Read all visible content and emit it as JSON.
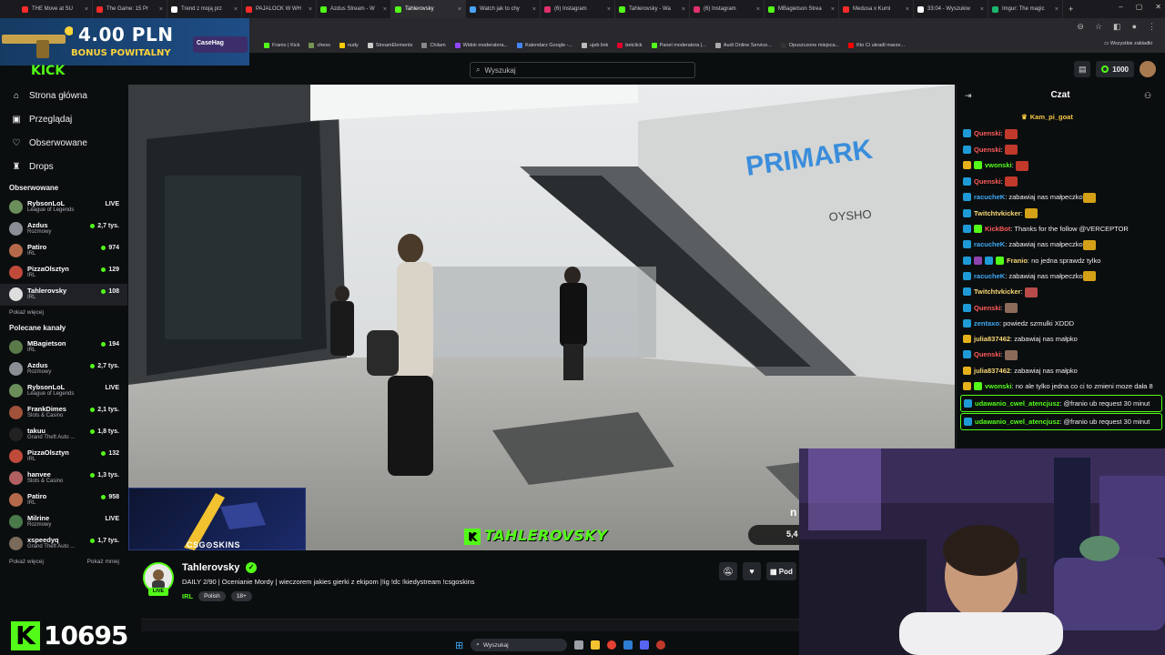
{
  "browser": {
    "tabs": [
      {
        "label": "THE Move at SU",
        "color": "#ff2b2b",
        "active": false
      },
      {
        "label": "The Game: 15 Pr",
        "color": "#ff2b2b",
        "active": false
      },
      {
        "label": "Trend z moją prz",
        "color": "#ffffff",
        "active": false
      },
      {
        "label": "PAJALOCK W WH",
        "color": "#ff2b2b",
        "active": false
      },
      {
        "label": "Azdus Stream - W",
        "color": "#53fc18",
        "active": false
      },
      {
        "label": "Tahlerovsky",
        "color": "#53fc18",
        "active": true
      },
      {
        "label": "Watch jak to chy",
        "color": "#4aa3ff",
        "active": false
      },
      {
        "label": "(6) Instagram",
        "color": "#e1306c",
        "active": false
      },
      {
        "label": "Tahlerovsky - Wa",
        "color": "#53fc18",
        "active": false
      },
      {
        "label": "(6) Instagram",
        "color": "#e1306c",
        "active": false
      },
      {
        "label": "MBagietson Strea",
        "color": "#53fc18",
        "active": false
      },
      {
        "label": "Medusa x Kumi",
        "color": "#ff2b2b",
        "active": false
      },
      {
        "label": "33:04 - Wyszukiw",
        "color": "#ffffff",
        "active": false
      },
      {
        "label": "Imgur: The magic",
        "color": "#1bb76e",
        "active": false
      }
    ],
    "bookmarks": [
      {
        "label": "Franio | Kick",
        "color": "#53fc18"
      },
      {
        "label": "chess",
        "color": "#769656"
      },
      {
        "label": "nudy",
        "color": "#ffcc00"
      },
      {
        "label": "StreamElements",
        "color": "#cccccc"
      },
      {
        "label": "Chilam",
        "color": "#888888"
      },
      {
        "label": "Widok moderatora...",
        "color": "#9147ff"
      },
      {
        "label": "Kalendarz Google -...",
        "color": "#4285f4"
      },
      {
        "label": "ujeb link",
        "color": "#bbbbbb"
      },
      {
        "label": "betclick",
        "color": "#e4002b"
      },
      {
        "label": "Panel moderatora |...",
        "color": "#53fc18"
      },
      {
        "label": "Audi Online Service...",
        "color": "#aaaaaa"
      },
      {
        "label": "Opuszczone miejsca...",
        "color": "#333333"
      },
      {
        "label": "Kto Ci ukradł marze...",
        "color": "#ff0000"
      }
    ],
    "bookmarks_all": "Wszystkie zakładki"
  },
  "promo": {
    "amount": "4.00 PLN",
    "subtitle": "BONUS POWITALNY",
    "brand": "CaseHag"
  },
  "header": {
    "search_placeholder": "Wyszukaj",
    "points": "1000"
  },
  "sidebar": {
    "nav": [
      {
        "label": "Strona główna",
        "icon": "home-icon",
        "glyph": "⌂"
      },
      {
        "label": "Przeglądaj",
        "icon": "browse-icon",
        "glyph": "▣"
      },
      {
        "label": "Obserwowane",
        "icon": "heart-icon",
        "glyph": "♡"
      },
      {
        "label": "Drops",
        "icon": "drops-icon",
        "glyph": "♜"
      }
    ],
    "followed_title": "Obserwowane",
    "followed": [
      {
        "name": "RybsonLoL",
        "category": "League of Legends",
        "viewers": "LIVE",
        "dot": false,
        "color": "#6b8e5a"
      },
      {
        "name": "Azdus",
        "category": "Rozmowy",
        "viewers": "2,7 tys.",
        "dot": true,
        "color": "#8a8f96"
      },
      {
        "name": "Patiro",
        "category": "IRL",
        "viewers": "974",
        "dot": true,
        "color": "#b46a4a"
      },
      {
        "name": "PizzaOlsztyn",
        "category": "IRL",
        "viewers": "129",
        "dot": true,
        "color": "#c04a3a"
      },
      {
        "name": "Tahlerovsky",
        "category": "IRL",
        "viewers": "108",
        "dot": true,
        "color": "#dddddd",
        "selected": true
      }
    ],
    "show_more": "Pokaż więcej",
    "recommended_title": "Polecane kanały",
    "recommended": [
      {
        "name": "MBagietson",
        "category": "IRL",
        "viewers": "194",
        "dot": true,
        "color": "#5a7a4a"
      },
      {
        "name": "Azdus",
        "category": "Rozmowy",
        "viewers": "2,7 tys.",
        "dot": true,
        "color": "#8a8f96"
      },
      {
        "name": "RybsonLoL",
        "category": "League of Legends",
        "viewers": "LIVE",
        "dot": false,
        "color": "#6b8e5a"
      },
      {
        "name": "FrankDimes",
        "category": "Slots & Casino",
        "viewers": "2,1 tys.",
        "dot": true,
        "color": "#a0523a"
      },
      {
        "name": "takuu",
        "category": "Grand Theft Auto ...",
        "viewers": "1,8 tys.",
        "dot": true,
        "color": "#222222"
      },
      {
        "name": "PizzaOlsztyn",
        "category": "IRL",
        "viewers": "132",
        "dot": true,
        "color": "#c04a3a"
      },
      {
        "name": "hanvee",
        "category": "Slots & Casino",
        "viewers": "1,3 tys.",
        "dot": true,
        "color": "#b06060"
      },
      {
        "name": "Patiro",
        "category": "IRL",
        "viewers": "958",
        "dot": true,
        "color": "#b46a4a"
      },
      {
        "name": "Milrine",
        "category": "Rozmowy",
        "viewers": "LIVE",
        "dot": false,
        "color": "#4a7a4a"
      },
      {
        "name": "xspeedyq",
        "category": "Grand Theft Auto ...",
        "viewers": "1,7 tys.",
        "dot": true,
        "color": "#7a6a5a"
      }
    ],
    "show_more2": "Pokaż więcej",
    "show_less": "Pokaż mniej"
  },
  "video": {
    "watermark": "TAHLEROVSKY",
    "sponsor": "CSG⊙SKINS",
    "overlay_value": "5,4",
    "overlay_letter": "n"
  },
  "stream": {
    "name": "Tahlerovsky",
    "title": "DAILY 2/90 | Ocenianie Mordy | wieczorem jakies gierki z ekipom |!ig !dc !kiedystream !csgoskins",
    "category": "IRL",
    "tags": [
      "Polish",
      "18+"
    ],
    "live": "LIVE",
    "subscribe": "Pod"
  },
  "counter": "10695",
  "taskbar": {
    "search": "Wyszukaj"
  },
  "chat": {
    "title": "Czat",
    "pinned_user": "Kam_pi_goat",
    "messages": [
      {
        "user": "Quenski",
        "color": "#ff5b5b",
        "text": "",
        "emote": "#c0392b",
        "badges": [
          "#1e9bd7"
        ]
      },
      {
        "user": "Quenski",
        "color": "#ff5b5b",
        "text": "",
        "emote": "#c0392b",
        "badges": [
          "#1e9bd7"
        ]
      },
      {
        "user": "vwonski",
        "color": "#53fc18",
        "text": "",
        "emote": "#c0392b",
        "badges": [
          "#e5b21c",
          "#53fc18"
        ]
      },
      {
        "user": "Quenski",
        "color": "#ff5b5b",
        "text": "",
        "emote": "#c0392b",
        "badges": [
          "#1e9bd7"
        ]
      },
      {
        "user": "racucheK",
        "color": "#3fa9f5",
        "text": "zabawiaj nas małpeczko",
        "emote": "#d4a017",
        "badges": [
          "#1e9bd7"
        ]
      },
      {
        "user": "Twitchtvkicker",
        "color": "#f7d774",
        "text": "",
        "emote": "#d4a017",
        "badges": [
          "#1e9bd7"
        ]
      },
      {
        "user": "KickBot",
        "color": "#ff5b5b",
        "text": "Thanks for the follow @VERCEPTOR",
        "emote": "",
        "badges": [
          "#1e9bd7",
          "#53fc18"
        ]
      },
      {
        "user": "racucheK",
        "color": "#3fa9f5",
        "text": "zabawiaj nas małpeczko",
        "emote": "#d4a017",
        "badges": [
          "#1e9bd7"
        ]
      },
      {
        "user": "Franio",
        "color": "#f7d774",
        "text": "no jedna sprawdz tylko",
        "emote": "",
        "badges": [
          "#1e9bd7",
          "#8e44ad",
          "#1e9bd7",
          "#53fc18"
        ]
      },
      {
        "user": "racucheK",
        "color": "#3fa9f5",
        "text": "zabawiaj nas małpeczko",
        "emote": "#d4a017",
        "badges": [
          "#1e9bd7"
        ]
      },
      {
        "user": "Twitchtvkicker",
        "color": "#f7d774",
        "text": "",
        "emote": "#b84a4a",
        "badges": [
          "#1e9bd7"
        ]
      },
      {
        "user": "Quenski",
        "color": "#ff5b5b",
        "text": "",
        "emote": "#8a6a5a",
        "badges": [
          "#1e9bd7"
        ]
      },
      {
        "user": "zentaxo",
        "color": "#3fa9f5",
        "text": "powiedz szmulki XDDD",
        "emote": "",
        "badges": [
          "#1e9bd7"
        ]
      },
      {
        "user": "julia837462",
        "color": "#f7d774",
        "text": "zabawiaj nas małpko",
        "emote": "",
        "badges": [
          "#e5b21c"
        ]
      },
      {
        "user": "Quenski",
        "color": "#ff5b5b",
        "text": "",
        "emote": "#8a6a5a",
        "badges": [
          "#1e9bd7"
        ]
      },
      {
        "user": "julia837462",
        "color": "#f7d774",
        "text": "zabawiaj nas małpko",
        "emote": "",
        "badges": [
          "#e5b21c"
        ]
      },
      {
        "user": "vwonski",
        "color": "#53fc18",
        "text": "no ale tylko jedna co ci to zmieni moze dała 8",
        "emote": "",
        "badges": [
          "#e5b21c",
          "#53fc18"
        ]
      },
      {
        "user": "udawanio_cwel_atencjusz",
        "color": "#53fc18",
        "text": "@franio ub request 30 minut",
        "emote": "",
        "badges": [
          "#1e9bd7"
        ],
        "highlight": true
      },
      {
        "user": "udawanio_cwel_atencjusz",
        "color": "#53fc18",
        "text": "@franio ub request 30 minut",
        "emote": "",
        "badges": [
          "#1e9bd7"
        ],
        "highlight": true
      }
    ]
  }
}
